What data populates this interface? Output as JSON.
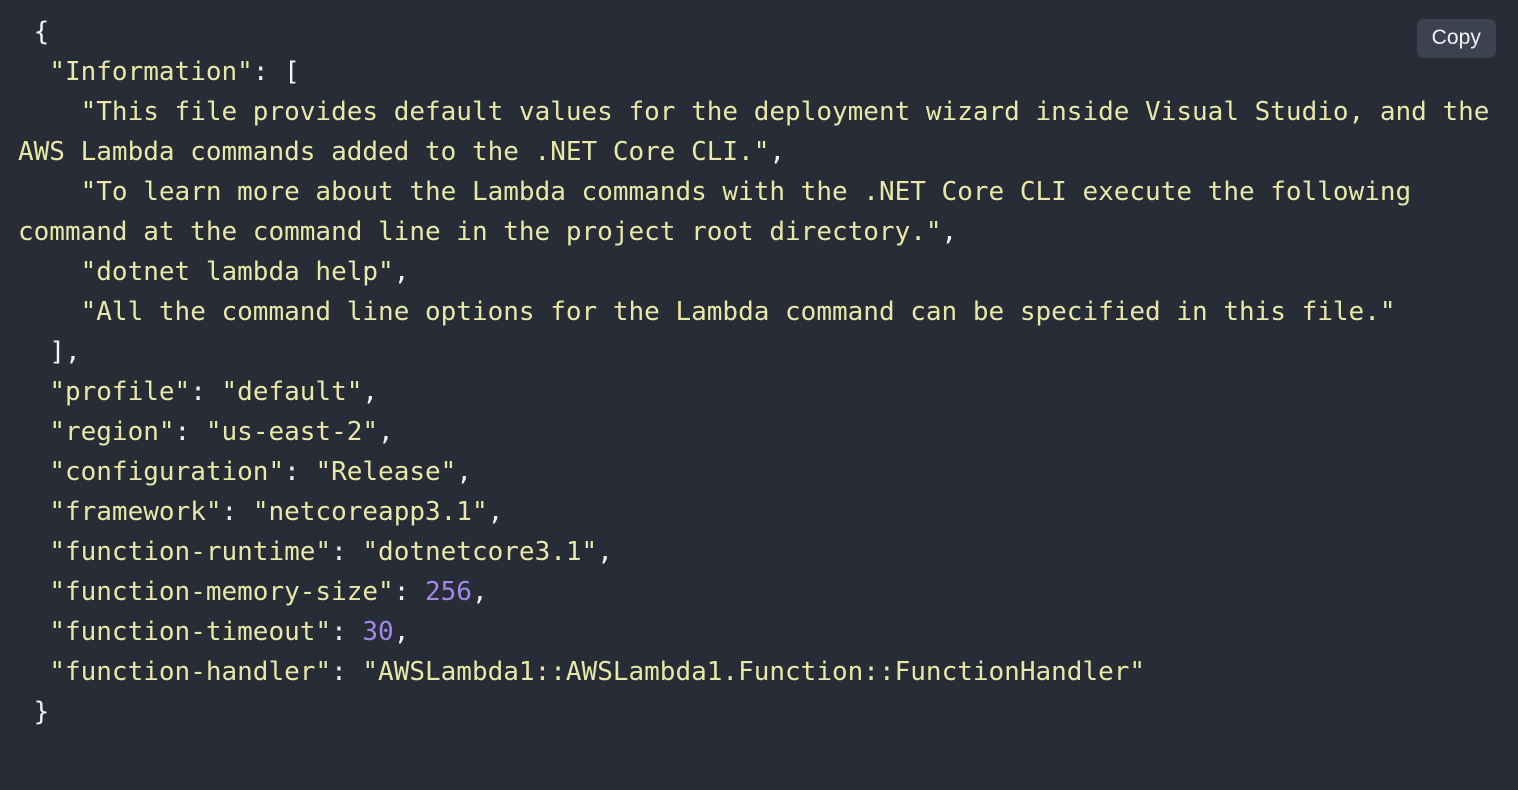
{
  "theme": {
    "background": "#282c37",
    "string_color": "#e8e8a8",
    "key_color": "#e8e8a8",
    "number_color": "#a387e8",
    "punctuation_color": "#f4f4f6",
    "button_background": "#3d4250",
    "button_text_color": "#f2f3f5"
  },
  "toolbar": {
    "copy_label": "Copy"
  },
  "code": {
    "language": "json",
    "lines": [
      {
        "indent": 1,
        "tokens": [
          {
            "t": "punct",
            "v": "{"
          }
        ]
      },
      {
        "indent": 2,
        "tokens": [
          {
            "t": "key",
            "v": "\"Information\""
          },
          {
            "t": "punct",
            "v": ": ["
          }
        ]
      },
      {
        "indent": 4,
        "tokens": [
          {
            "t": "str",
            "v": "\"This file provides default values for the deployment wizard inside Visual Studio, and the AWS Lambda commands added to the .NET Core CLI.\""
          },
          {
            "t": "punct",
            "v": ","
          }
        ]
      },
      {
        "indent": 4,
        "tokens": [
          {
            "t": "str",
            "v": "\"To learn more about the Lambda commands with the .NET Core CLI execute the following command at the command line in the project root directory.\""
          },
          {
            "t": "punct",
            "v": ","
          }
        ]
      },
      {
        "indent": 4,
        "tokens": [
          {
            "t": "str",
            "v": "\"dotnet lambda help\""
          },
          {
            "t": "punct",
            "v": ","
          }
        ]
      },
      {
        "indent": 4,
        "tokens": [
          {
            "t": "str",
            "v": "\"All the command line options for the Lambda command can be specified in this file.\""
          }
        ]
      },
      {
        "indent": 2,
        "tokens": [
          {
            "t": "punct",
            "v": "],"
          }
        ]
      },
      {
        "indent": 2,
        "tokens": [
          {
            "t": "key",
            "v": "\"profile\""
          },
          {
            "t": "punct",
            "v": ": "
          },
          {
            "t": "str",
            "v": "\"default\""
          },
          {
            "t": "punct",
            "v": ","
          }
        ]
      },
      {
        "indent": 2,
        "tokens": [
          {
            "t": "key",
            "v": "\"region\""
          },
          {
            "t": "punct",
            "v": ": "
          },
          {
            "t": "str",
            "v": "\"us-east-2\""
          },
          {
            "t": "punct",
            "v": ","
          }
        ]
      },
      {
        "indent": 2,
        "tokens": [
          {
            "t": "key",
            "v": "\"configuration\""
          },
          {
            "t": "punct",
            "v": ": "
          },
          {
            "t": "str",
            "v": "\"Release\""
          },
          {
            "t": "punct",
            "v": ","
          }
        ]
      },
      {
        "indent": 2,
        "tokens": [
          {
            "t": "key",
            "v": "\"framework\""
          },
          {
            "t": "punct",
            "v": ": "
          },
          {
            "t": "str",
            "v": "\"netcoreapp3.1\""
          },
          {
            "t": "punct",
            "v": ","
          }
        ]
      },
      {
        "indent": 2,
        "tokens": [
          {
            "t": "key",
            "v": "\"function-runtime\""
          },
          {
            "t": "punct",
            "v": ": "
          },
          {
            "t": "str",
            "v": "\"dotnetcore3.1\""
          },
          {
            "t": "punct",
            "v": ","
          }
        ]
      },
      {
        "indent": 2,
        "tokens": [
          {
            "t": "key",
            "v": "\"function-memory-size\""
          },
          {
            "t": "punct",
            "v": ": "
          },
          {
            "t": "num",
            "v": "256"
          },
          {
            "t": "punct",
            "v": ","
          }
        ]
      },
      {
        "indent": 2,
        "tokens": [
          {
            "t": "key",
            "v": "\"function-timeout\""
          },
          {
            "t": "punct",
            "v": ": "
          },
          {
            "t": "num",
            "v": "30"
          },
          {
            "t": "punct",
            "v": ","
          }
        ]
      },
      {
        "indent": 2,
        "tokens": [
          {
            "t": "key",
            "v": "\"function-handler\""
          },
          {
            "t": "punct",
            "v": ": "
          },
          {
            "t": "str",
            "v": "\"AWSLambda1::AWSLambda1.Function::FunctionHandler\""
          }
        ]
      },
      {
        "indent": 1,
        "tokens": [
          {
            "t": "punct",
            "v": "}"
          }
        ]
      }
    ]
  }
}
